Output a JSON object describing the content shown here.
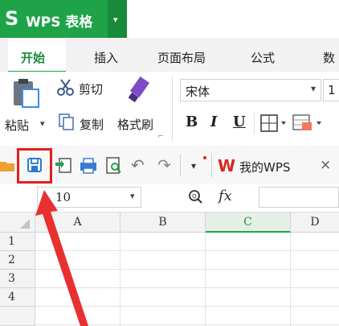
{
  "app": {
    "logo_glyph": "S",
    "title": "WPS 表格",
    "dropdown_glyph": "▾"
  },
  "tabs": [
    {
      "label": "开始",
      "active": true
    },
    {
      "label": "插入"
    },
    {
      "label": "页面布局"
    },
    {
      "label": "公式"
    },
    {
      "label": "数"
    }
  ],
  "clipboard": {
    "paste": "粘贴",
    "paste_dropdown": "▾",
    "cut": "剪切",
    "copy": "复制",
    "format_painter": "格式刷",
    "corner_glyph": "⌐"
  },
  "font": {
    "name": "宋体",
    "size": "1",
    "bold": "B",
    "italic": "I",
    "underline": "U"
  },
  "quick_access": {
    "doc_tab_label": "我的WPS",
    "doc_tab_close": "×"
  },
  "formula_bar": {
    "cell_ref": "10",
    "fx_label": "fx"
  },
  "sheet": {
    "columns": [
      "A",
      "B",
      "C",
      "D"
    ],
    "active_column": "C",
    "rows": [
      "1",
      "2",
      "3",
      "4"
    ]
  },
  "colors": {
    "brand_green": "#1ea348",
    "highlight_red": "#e02020",
    "wps_red": "#d9281f"
  }
}
